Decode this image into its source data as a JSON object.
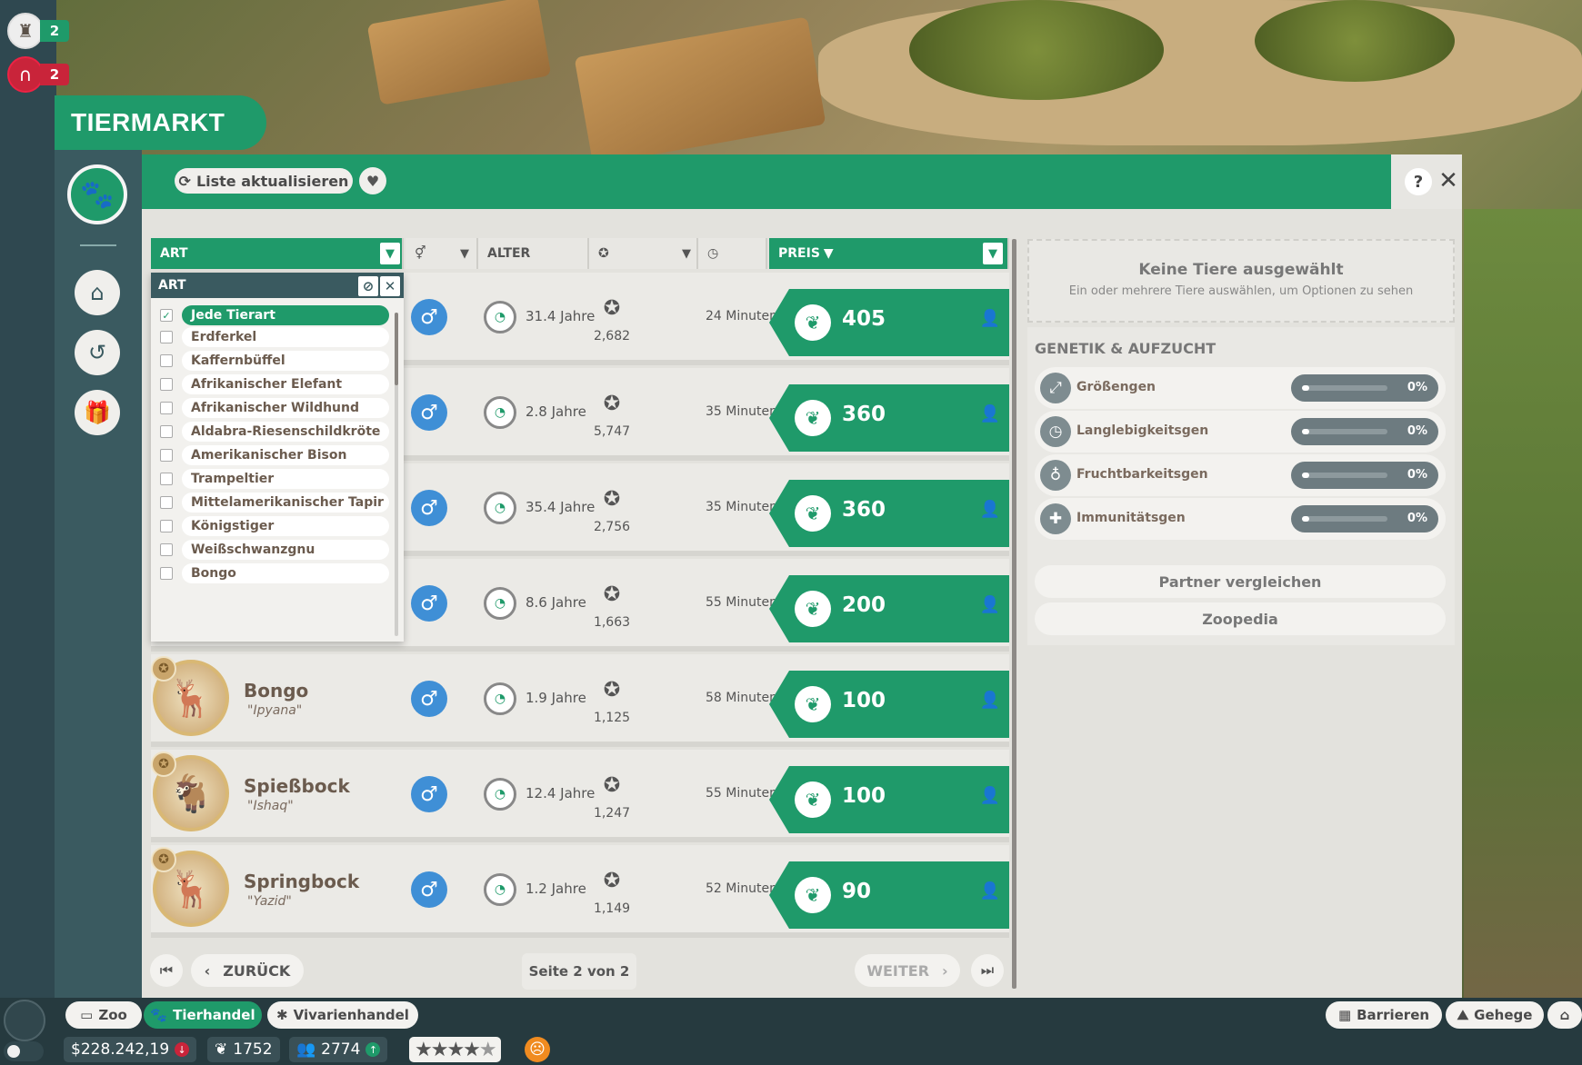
{
  "counters": [
    {
      "icon": "zookeeper-icon",
      "value": "2"
    },
    {
      "icon": "gate-icon",
      "value": "2"
    }
  ],
  "title": "TIERMARKT",
  "toolbar": {
    "refresh_label": "Liste aktualisieren"
  },
  "columns": {
    "species": "ART",
    "age": "ALTER",
    "price": "PREIS"
  },
  "dropdown": {
    "title": "ART",
    "options": [
      {
        "label": "Jede Tierart",
        "checked": true
      },
      {
        "label": "Erdferkel",
        "checked": false
      },
      {
        "label": "Kaffernbüffel",
        "checked": false
      },
      {
        "label": "Afrikanischer Elefant",
        "checked": false
      },
      {
        "label": "Afrikanischer Wildhund",
        "checked": false
      },
      {
        "label": "Aldabra-Riesenschildkröte",
        "checked": false
      },
      {
        "label": "Amerikanischer Bison",
        "checked": false
      },
      {
        "label": "Trampeltier",
        "checked": false
      },
      {
        "label": "Mittelamerikanischer Tapir",
        "checked": false
      },
      {
        "label": "Königstiger",
        "checked": false
      },
      {
        "label": "Weißschwanzgnu",
        "checked": false
      },
      {
        "label": "Bongo",
        "checked": false
      }
    ]
  },
  "animals": [
    {
      "name": "",
      "nick": "",
      "age": "31.4 Jahre",
      "rating": "2,682",
      "time": "24 Minuten",
      "price": "405"
    },
    {
      "name": "",
      "nick": "",
      "age": "2.8 Jahre",
      "rating": "5,747",
      "time": "35 Minuten",
      "price": "360"
    },
    {
      "name": "",
      "nick": "",
      "age": "35.4 Jahre",
      "rating": "2,756",
      "time": "35 Minuten",
      "price": "360"
    },
    {
      "name": "",
      "nick": "",
      "age": "8.6 Jahre",
      "rating": "1,663",
      "time": "55 Minuten",
      "price": "200"
    },
    {
      "name": "Bongo",
      "nick": "\"Ipyana\"",
      "age": "1.9 Jahre",
      "rating": "1,125",
      "time": "58 Minuten",
      "price": "100"
    },
    {
      "name": "Spießbock",
      "nick": "\"Ishaq\"",
      "age": "12.4 Jahre",
      "rating": "1,247",
      "time": "55 Minuten",
      "price": "100"
    },
    {
      "name": "Springbock",
      "nick": "\"Yazid\"",
      "age": "1.2 Jahre",
      "rating": "1,149",
      "time": "52 Minuten",
      "price": "90"
    }
  ],
  "selection": {
    "title": "Keine Tiere ausgewählt",
    "subtitle": "Ein oder mehrere Tiere auswählen, um Optionen zu sehen"
  },
  "genetics": {
    "title": "GENETIK & AUFZUCHT",
    "genes": [
      {
        "label": "Größengen",
        "value": "0%"
      },
      {
        "label": "Langlebigkeitsgen",
        "value": "0%"
      },
      {
        "label": "Fruchtbarkeitsgen",
        "value": "0%"
      },
      {
        "label": "Immunitätsgen",
        "value": "0%"
      }
    ],
    "compare_label": "Partner vergleichen",
    "zoopedia_label": "Zoopedia"
  },
  "pager": {
    "back_label": "ZURÜCK",
    "next_label": "WEITER",
    "page_label": "Seite 2 von 2"
  },
  "bottom": {
    "tabs": [
      "Zoo",
      "Tierhandel",
      "Vivarienhandel"
    ],
    "right_tabs": [
      "Barrieren",
      "Gehege"
    ],
    "money": "$228.242,19",
    "conservation": "1752",
    "guests": "2774",
    "rating_stars": 4.5
  },
  "colors": {
    "accent": "#1f9a6a",
    "panel": "#e3e2dd",
    "male": "#3f8fd6"
  }
}
